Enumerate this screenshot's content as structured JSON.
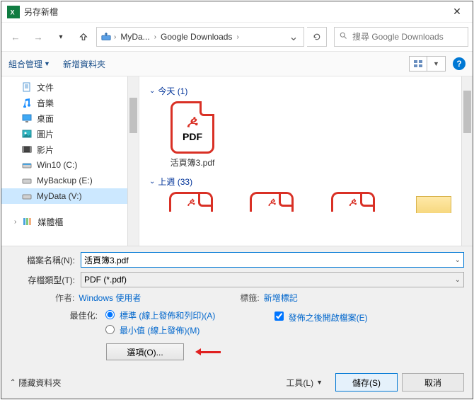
{
  "window": {
    "title": "另存新檔"
  },
  "nav": {
    "crumbs": [
      "MyDa...",
      "Google Downloads"
    ],
    "search_placeholder": "搜尋 Google Downloads"
  },
  "toolbar": {
    "organize": "組合管理",
    "new_folder": "新增資料夾"
  },
  "tree": {
    "items": [
      {
        "label": "文件",
        "icon": "doc"
      },
      {
        "label": "音樂",
        "icon": "music"
      },
      {
        "label": "桌面",
        "icon": "desktop"
      },
      {
        "label": "圖片",
        "icon": "pic"
      },
      {
        "label": "影片",
        "icon": "video"
      },
      {
        "label": "Win10 (C:)",
        "icon": "drive"
      },
      {
        "label": "MyBackup (E:)",
        "icon": "drive"
      },
      {
        "label": "MyData (V:)",
        "icon": "drive",
        "selected": true
      },
      {
        "label": "",
        "icon": "spacer"
      },
      {
        "label": "媒體櫃",
        "icon": "lib"
      }
    ]
  },
  "files": {
    "group1": {
      "title": "今天 (1)",
      "items": [
        {
          "name": "活頁簿3.pdf"
        }
      ]
    },
    "group2": {
      "title": "上週 (33)"
    }
  },
  "form": {
    "filename_label": "檔案名稱(N):",
    "filename_value": "活頁簿3.pdf",
    "filetype_label": "存檔類型(T):",
    "filetype_value": "PDF (*.pdf)",
    "author_label": "作者:",
    "author_value": "Windows 使用者",
    "tags_label": "標籤:",
    "tags_value": "新增標記",
    "optimize_label": "最佳化:",
    "opt1": "標準 (線上發佈和列印)(A)",
    "opt2": "最小值 (線上發佈)(M)",
    "open_after": "發佈之後開啟檔案(E)",
    "options_btn": "選項(O)..."
  },
  "footer": {
    "hide": "隱藏資料夾",
    "tools": "工具(L)",
    "save": "儲存(S)",
    "cancel": "取消"
  }
}
